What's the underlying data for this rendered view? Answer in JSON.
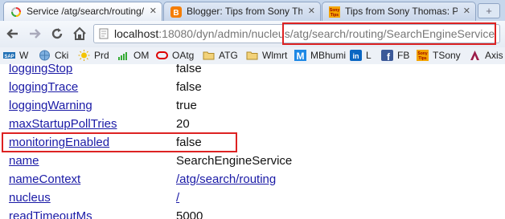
{
  "tabs": [
    {
      "title": "Service /atg/search/routing/Se",
      "icon": "spinner-icon",
      "active": true
    },
    {
      "title": "Blogger: Tips from Sony Thom",
      "icon": "blogger-icon",
      "active": false
    },
    {
      "title": "Tips from Sony Thomas: Previ",
      "icon": "sony-tips-icon",
      "active": false
    }
  ],
  "new_tab_label": "+",
  "url": {
    "host": "localhost",
    "path": ":18080/dyn/admin/nucleus/atg/search/routing/SearchEngineService"
  },
  "bookmarks": [
    {
      "label": "W",
      "icon": "sap-icon"
    },
    {
      "label": "Cki",
      "icon": "globe-icon"
    },
    {
      "label": "Prd",
      "icon": "sun-icon"
    },
    {
      "label": "OM",
      "icon": "bars-icon"
    },
    {
      "label": "OAtg",
      "icon": "oracle-icon"
    },
    {
      "label": "ATG",
      "icon": "folder-icon"
    },
    {
      "label": "Wlmrt",
      "icon": "folder-icon"
    },
    {
      "label": "MBhumi",
      "icon": "m-icon"
    },
    {
      "label": "L",
      "icon": "linkedin-icon"
    },
    {
      "label": "FB",
      "icon": "facebook-icon"
    },
    {
      "label": "TSony",
      "icon": "sony-tips-icon"
    },
    {
      "label": "Axis",
      "icon": "axis-icon"
    }
  ],
  "properties": [
    {
      "name": "loggingStop",
      "value": "false",
      "value_link": false
    },
    {
      "name": "loggingTrace",
      "value": "false",
      "value_link": false
    },
    {
      "name": "loggingWarning",
      "value": "true",
      "value_link": false
    },
    {
      "name": "maxStartupPollTries",
      "value": "20",
      "value_link": false
    },
    {
      "name": "monitoringEnabled",
      "value": "false",
      "value_link": false
    },
    {
      "name": "name",
      "value": "SearchEngineService",
      "value_link": false
    },
    {
      "name": "nameContext",
      "value": "/atg/search/routing",
      "value_link": true
    },
    {
      "name": "nucleus",
      "value": "/",
      "value_link": true
    },
    {
      "name": "readTimeoutMs",
      "value": "5000",
      "value_link": false
    }
  ],
  "colors": {
    "highlight": "#dd2222",
    "link": "#1a1aa6"
  }
}
